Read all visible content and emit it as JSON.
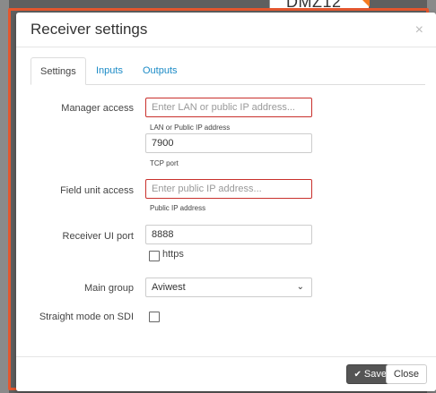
{
  "background": {
    "card_title": "DMZ12"
  },
  "modal": {
    "title": "Receiver settings",
    "close_glyph": "×"
  },
  "tabs": [
    {
      "label": "Settings",
      "active": true
    },
    {
      "label": "Inputs",
      "active": false
    },
    {
      "label": "Outputs",
      "active": false
    }
  ],
  "form": {
    "manager_access": {
      "label": "Manager access",
      "placeholder": "Enter LAN or public IP address...",
      "help": "LAN or Public IP address",
      "port_value": "7900",
      "port_help": "TCP port"
    },
    "field_unit_access": {
      "label": "Field unit access",
      "placeholder": "Enter public IP address...",
      "help": "Public IP address"
    },
    "receiver_ui_port": {
      "label": "Receiver UI port",
      "value": "8888",
      "https_label": "https",
      "https_checked": false
    },
    "main_group": {
      "label": "Main group",
      "selected": "Aviwest"
    },
    "straight_mode": {
      "label": "Straight mode on SDI",
      "checked": false
    }
  },
  "footer": {
    "save_label": "Save",
    "close_label": "Close"
  },
  "colors": {
    "accent": "#1a8ac6",
    "error_border": "#c9302c",
    "highlight_outline": "#e4572e",
    "save_button": "#555555"
  }
}
